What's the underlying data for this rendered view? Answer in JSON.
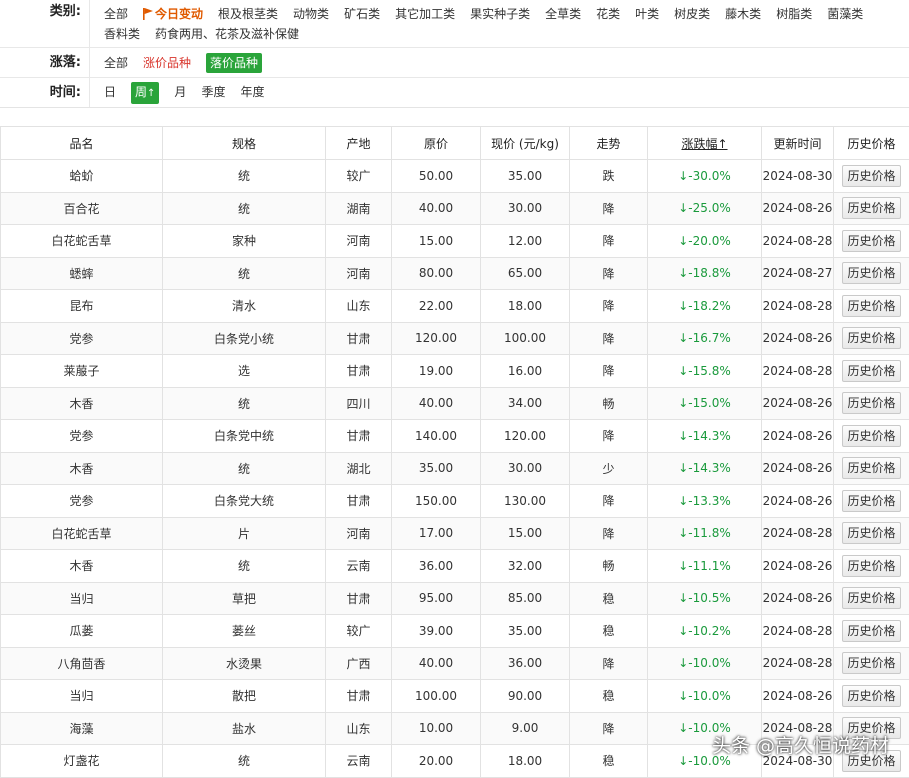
{
  "filters": {
    "category": {
      "label": "类别:",
      "items": [
        "全部",
        "今日变动",
        "根及根茎类",
        "动物类",
        "矿石类",
        "其它加工类",
        "果实种子类",
        "全草类",
        "花类",
        "叶类",
        "树皮类",
        "藤木类",
        "树脂类",
        "菌藻类",
        "香料类",
        "药食两用、花茶及滋补保健"
      ]
    },
    "change": {
      "label": "涨落:",
      "items": [
        "全部",
        "涨价品种",
        "落价品种"
      ]
    },
    "time": {
      "label": "时间:",
      "items": [
        "日",
        "周",
        "月",
        "季度",
        "年度"
      ],
      "active_arrow": "↑"
    }
  },
  "table": {
    "headers": [
      "品名",
      "规格",
      "产地",
      "原价",
      "现价 (元/kg)",
      "走势",
      "涨跌幅↑",
      "更新时间",
      "历史价格"
    ],
    "history_button": "历史价格",
    "rows": [
      [
        "蛤蚧",
        "统",
        "较广",
        "50.00",
        "35.00",
        "跌",
        "↓-30.0%",
        "2024-08-30"
      ],
      [
        "百合花",
        "统",
        "湖南",
        "40.00",
        "30.00",
        "降",
        "↓-25.0%",
        "2024-08-26"
      ],
      [
        "白花蛇舌草",
        "家种",
        "河南",
        "15.00",
        "12.00",
        "降",
        "↓-20.0%",
        "2024-08-28"
      ],
      [
        "蟋蟀",
        "统",
        "河南",
        "80.00",
        "65.00",
        "降",
        "↓-18.8%",
        "2024-08-27"
      ],
      [
        "昆布",
        "清水",
        "山东",
        "22.00",
        "18.00",
        "降",
        "↓-18.2%",
        "2024-08-28"
      ],
      [
        "党参",
        "白条党小统",
        "甘肃",
        "120.00",
        "100.00",
        "降",
        "↓-16.7%",
        "2024-08-26"
      ],
      [
        "莱菔子",
        "选",
        "甘肃",
        "19.00",
        "16.00",
        "降",
        "↓-15.8%",
        "2024-08-28"
      ],
      [
        "木香",
        "统",
        "四川",
        "40.00",
        "34.00",
        "畅",
        "↓-15.0%",
        "2024-08-26"
      ],
      [
        "党参",
        "白条党中统",
        "甘肃",
        "140.00",
        "120.00",
        "降",
        "↓-14.3%",
        "2024-08-26"
      ],
      [
        "木香",
        "统",
        "湖北",
        "35.00",
        "30.00",
        "少",
        "↓-14.3%",
        "2024-08-26"
      ],
      [
        "党参",
        "白条党大统",
        "甘肃",
        "150.00",
        "130.00",
        "降",
        "↓-13.3%",
        "2024-08-26"
      ],
      [
        "白花蛇舌草",
        "片",
        "河南",
        "17.00",
        "15.00",
        "降",
        "↓-11.8%",
        "2024-08-28"
      ],
      [
        "木香",
        "统",
        "云南",
        "36.00",
        "32.00",
        "畅",
        "↓-11.1%",
        "2024-08-26"
      ],
      [
        "当归",
        "草把",
        "甘肃",
        "95.00",
        "85.00",
        "稳",
        "↓-10.5%",
        "2024-08-26"
      ],
      [
        "瓜蒌",
        "蒌丝",
        "较广",
        "39.00",
        "35.00",
        "稳",
        "↓-10.2%",
        "2024-08-28"
      ],
      [
        "八角茴香",
        "水烫果",
        "广西",
        "40.00",
        "36.00",
        "降",
        "↓-10.0%",
        "2024-08-28"
      ],
      [
        "当归",
        "散把",
        "甘肃",
        "100.00",
        "90.00",
        "稳",
        "↓-10.0%",
        "2024-08-26"
      ],
      [
        "海藻",
        "盐水",
        "山东",
        "10.00",
        "9.00",
        "降",
        "↓-10.0%",
        "2024-08-28"
      ],
      [
        "灯盏花",
        "统",
        "云南",
        "20.00",
        "18.00",
        "稳",
        "↓-10.0%",
        "2024-08-30"
      ]
    ]
  },
  "watermark": "头条 @高久恒说药材",
  "colors": {
    "accent_orange": "#e05a00",
    "up_red": "#d8342b",
    "down_green": "#2aa43a",
    "change_text": "#1a9a3c"
  }
}
